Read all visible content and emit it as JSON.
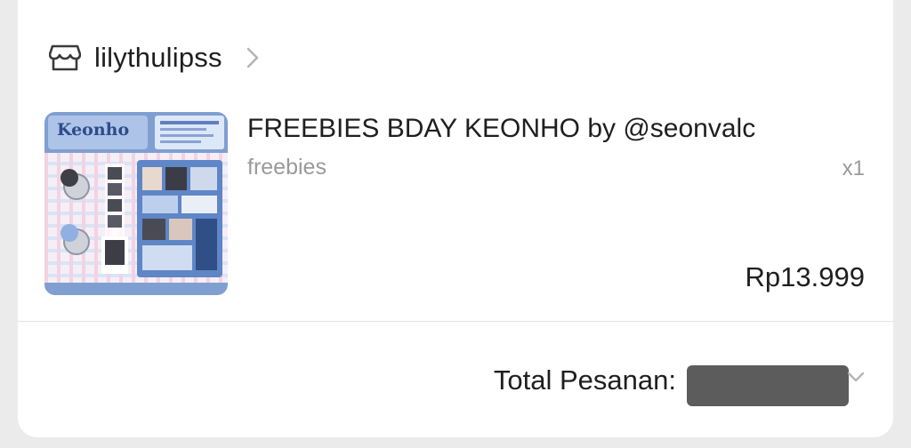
{
  "shop": {
    "name": "lilythulipss",
    "icon": "shop-icon",
    "chevron_icon": "chevron-right-icon"
  },
  "product": {
    "title": "FREEBIES BDAY KEONHO by @seonvalc",
    "variation": "freebies",
    "quantity": "x1",
    "price": "Rp13.999",
    "thumbnail_text": "Keonho"
  },
  "order": {
    "total_label": "Total Pesanan:",
    "total_value_redacted": true,
    "expand_icon": "chevron-down-icon"
  },
  "colors": {
    "text_primary": "#1f1f1f",
    "text_secondary": "#9a9a9a",
    "redaction": "#5c5c5c",
    "thumb_blue": "#6b8fc7",
    "thumb_pink": "#f3c7d6"
  }
}
